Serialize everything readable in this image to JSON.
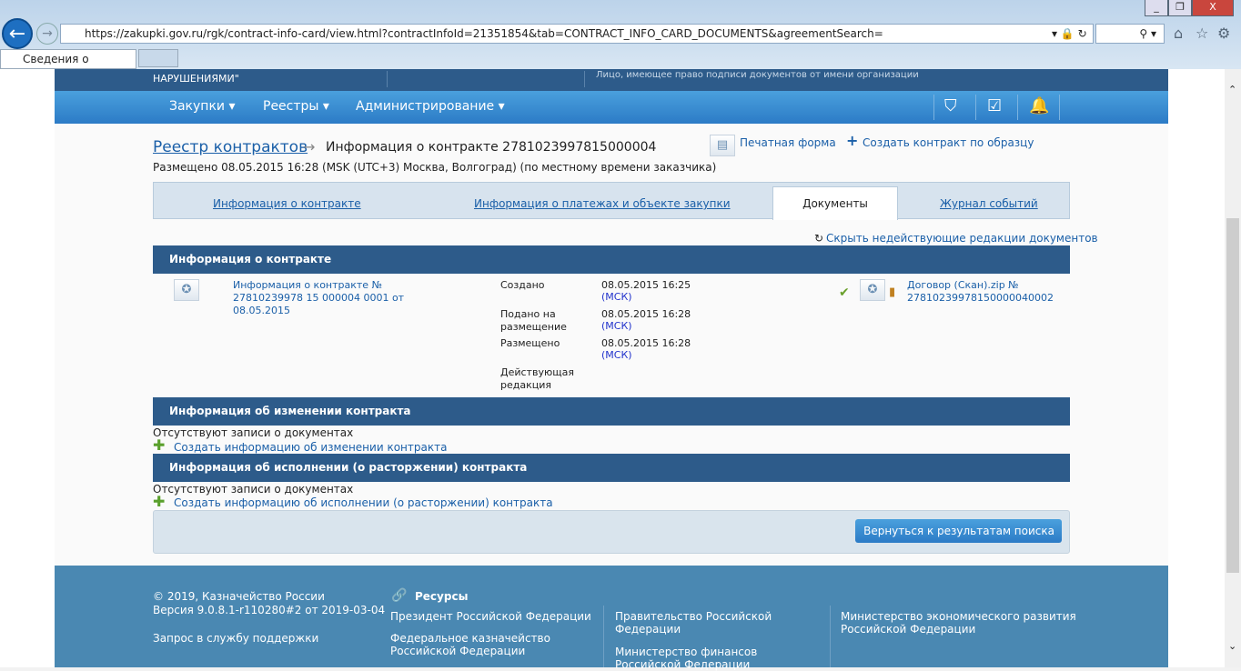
{
  "browser": {
    "url": "https://zakupki.gov.ru/rgk/contract-info-card/view.html?contractInfoId=21351854&tab=CONTRACT_INFO_CARD_DOCUMENTS&agreementSearch=",
    "tab_title": "Сведения о контракте",
    "search_icon": "search-icon"
  },
  "topbar": {
    "org_tail": "НАРУШЕНИЯМИ\"",
    "signer": "Лицо, имеющее право подписи документов от имени организации"
  },
  "nav": {
    "items": [
      "Закупки",
      "Реестры",
      "Администрирование"
    ]
  },
  "breadcrumb": {
    "root": "Реестр контрактов",
    "current": "Информация о контракте 2781023997815000004"
  },
  "actions": {
    "print": "Печатная форма",
    "create": "Создать контракт по образцу"
  },
  "placed": "Размещено 08.05.2015 16:28 (MSK (UTC+3) Москва, Волгоград) (по местному времени заказчика)",
  "tabs": [
    "Информация о контракте",
    "Информация о платежах и объекте закупки",
    "Документы",
    "Журнал событий"
  ],
  "hide_link": "Скрыть недействующие редакции документов",
  "sections": {
    "contract": {
      "title": "Информация о контракте",
      "doc_link": "Информация о контракте № 27810239978 15 000004 0001 от 08.05.2015",
      "fields": [
        {
          "label": "Создано",
          "value": "08.05.2015 16:25",
          "tz": "(МСК)"
        },
        {
          "label": "Подано на размещение",
          "value": "08.05.2015 16:28",
          "tz": "(МСК)"
        },
        {
          "label": "Размещено",
          "value": "08.05.2015 16:28",
          "tz": "(МСК)"
        },
        {
          "label": "Действующая редакция",
          "value": "",
          "tz": ""
        }
      ],
      "file": "Договор (Скан).zip № 27810239978150000040002"
    },
    "change": {
      "title": "Информация об изменении контракта",
      "empty": "Отсутствуют записи о документах",
      "create": "Создать информацию об изменении контракта"
    },
    "exec": {
      "title": "Информация об исполнении (о расторжении) контракта",
      "empty": "Отсутствуют записи о документах",
      "create": "Создать информацию об исполнении (о расторжении) контракта"
    }
  },
  "back_button": "Вернуться к результатам поиска",
  "footer": {
    "copyright": "© 2019, Казначейство России",
    "version": "Версия 9.0.8.1-r110280#2 от 2019-03-04",
    "support": "Запрос в службу поддержки",
    "resources": "Ресурсы",
    "links": [
      "Президент Российской Федерации",
      "Федеральное казначейство Российской Федерации",
      "Правительство Российской Федерации",
      "Министерство финансов Российской Федерации",
      "Министерство экономического развития Российской Федерации"
    ]
  }
}
